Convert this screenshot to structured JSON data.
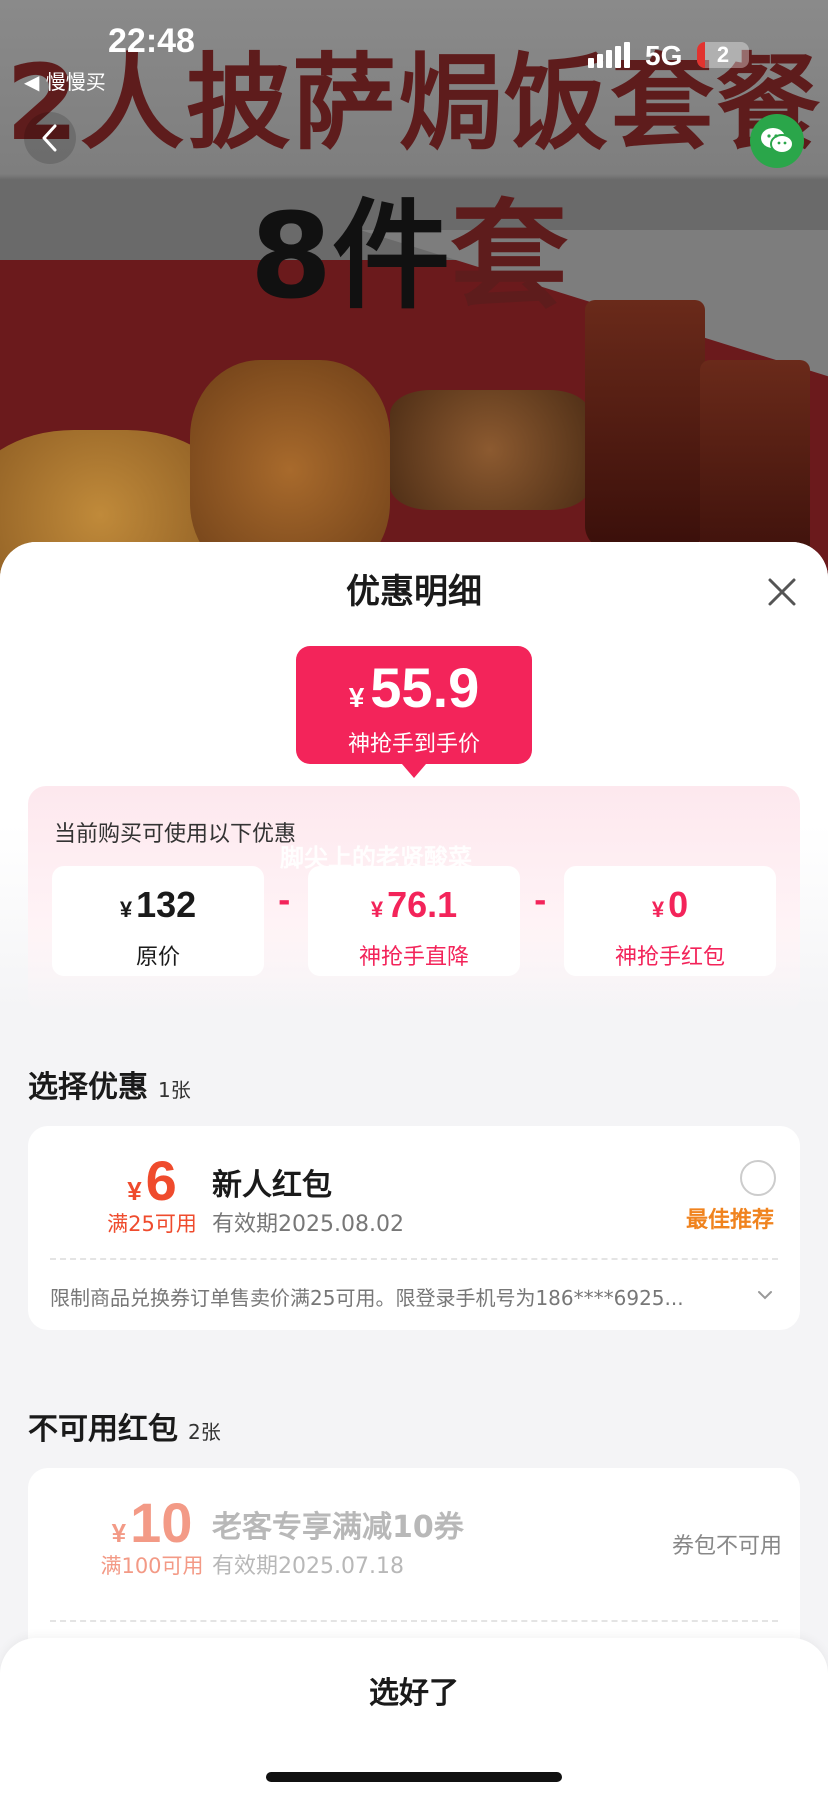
{
  "status_bar": {
    "time": "22:48",
    "back_app": "◀ 慢慢买",
    "network": "5G",
    "battery": "2"
  },
  "hero": {
    "title_line1": "2人披萨焗饭套餐",
    "title_line2_num": "8件",
    "title_line2_red": "套"
  },
  "sheet": {
    "title": "优惠明细",
    "price": {
      "currency": "¥",
      "value": "55.9",
      "label": "神抢手到手价"
    },
    "discount": {
      "heading": "当前购买可使用以下优惠",
      "watermark": "脚尖上的老贤酸菜",
      "items": [
        {
          "currency": "¥",
          "value": "132",
          "label": "原价"
        },
        {
          "currency": "¥",
          "value": "76.1",
          "label": "神抢手直降"
        },
        {
          "currency": "¥",
          "value": "0",
          "label": "神抢手红包"
        }
      ],
      "operator": "-"
    },
    "select_section": {
      "title": "选择优惠",
      "count": "1张"
    },
    "available_coupon": {
      "currency": "¥",
      "amount": "6",
      "condition": "满25可用",
      "name": "新人红包",
      "expiry": "有效期2025.08.02",
      "tag": "最佳推荐",
      "description": "限制商品兑换券订单售卖价满25可用。限登录手机号为186****6925..."
    },
    "unavailable_section": {
      "title": "不可用红包",
      "count": "2张"
    },
    "unavailable_coupon": {
      "currency": "¥",
      "amount": "10",
      "condition": "满100可用",
      "name": "老客专享满减10券",
      "expiry": "有效期2025.07.18",
      "status": "券包不可用"
    },
    "confirm_label": "选好了"
  },
  "colors": {
    "accent": "#f3245a",
    "coupon_red": "#ef4b2d",
    "recommend_orange": "#f0831e",
    "wechat_green": "#2aa64a"
  }
}
